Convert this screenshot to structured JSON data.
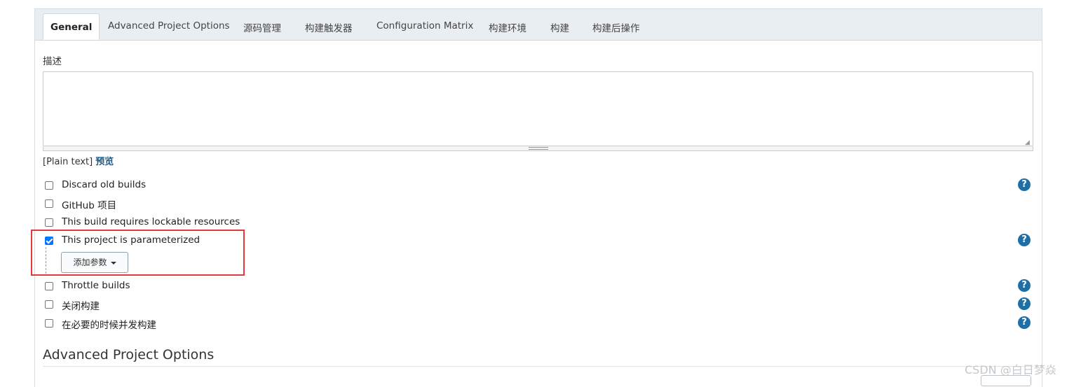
{
  "tabs": [
    {
      "label": "General",
      "active": true
    },
    {
      "label": "Advanced Project Options"
    },
    {
      "label": "源码管理"
    },
    {
      "label": "构建触发器"
    },
    {
      "label": "Configuration Matrix"
    },
    {
      "label": "构建环境"
    },
    {
      "label": "构建"
    },
    {
      "label": "构建后操作"
    }
  ],
  "description": {
    "label": "描述",
    "value": "",
    "format_label": "[Plain text]",
    "preview_link": "预览"
  },
  "options": [
    {
      "label": "Discard old builds",
      "checked": false,
      "help": true
    },
    {
      "label": "GitHub 项目",
      "checked": false,
      "help": false
    },
    {
      "label": "This build requires lockable resources",
      "checked": false,
      "help": false
    },
    {
      "label": "This project is parameterized",
      "checked": true,
      "help": true
    },
    {
      "label": "Throttle builds",
      "checked": false,
      "help": true
    },
    {
      "label": "关闭构建",
      "checked": false,
      "help": true
    },
    {
      "label": "在必要的时候并发构建",
      "checked": false,
      "help": true
    }
  ],
  "add_param_button": "添加参数",
  "help_symbol": "?",
  "section_title": "Advanced Project Options",
  "watermark": "CSDN @白日梦焱",
  "colors": {
    "accent": "#1d6fa5",
    "highlight": "#e03a3a",
    "checkbox_checked": "#0075ff"
  }
}
